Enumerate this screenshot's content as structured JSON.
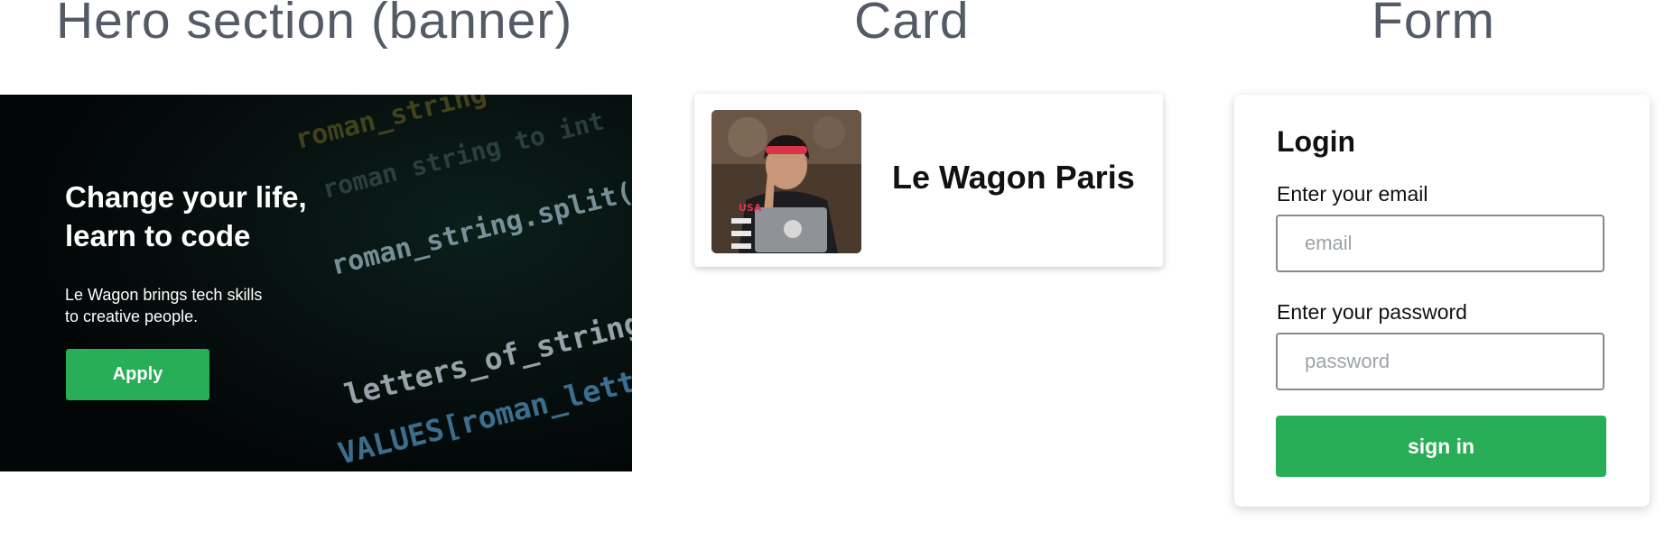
{
  "sections": {
    "hero_title": "Hero section (banner)",
    "card_title": "Card",
    "form_title": "Form"
  },
  "hero": {
    "headline_line1": "Change your life,",
    "headline_line2": "learn to code",
    "subtitle_line1": "Le Wagon brings tech skills",
    "subtitle_line2": "to creative people.",
    "button_label": "Apply",
    "background_code_lines": [
      "roman_string",
      "roman string to int",
      "roman_string.split(\"\")",
      "letters_of_string.map",
      "VALUES[roman_letter]",
      "roman_letter"
    ]
  },
  "card": {
    "title": "Le Wagon Paris",
    "image_label": "USA"
  },
  "form": {
    "title": "Login",
    "email_label": "Enter your email",
    "email_placeholder": "email",
    "email_value": "",
    "password_label": "Enter your password",
    "password_placeholder": "password",
    "password_value": "",
    "submit_label": "sign in"
  },
  "colors": {
    "accent_green": "#27ae56",
    "heading_gray": "#555b66",
    "hero_background": "#05090a"
  }
}
